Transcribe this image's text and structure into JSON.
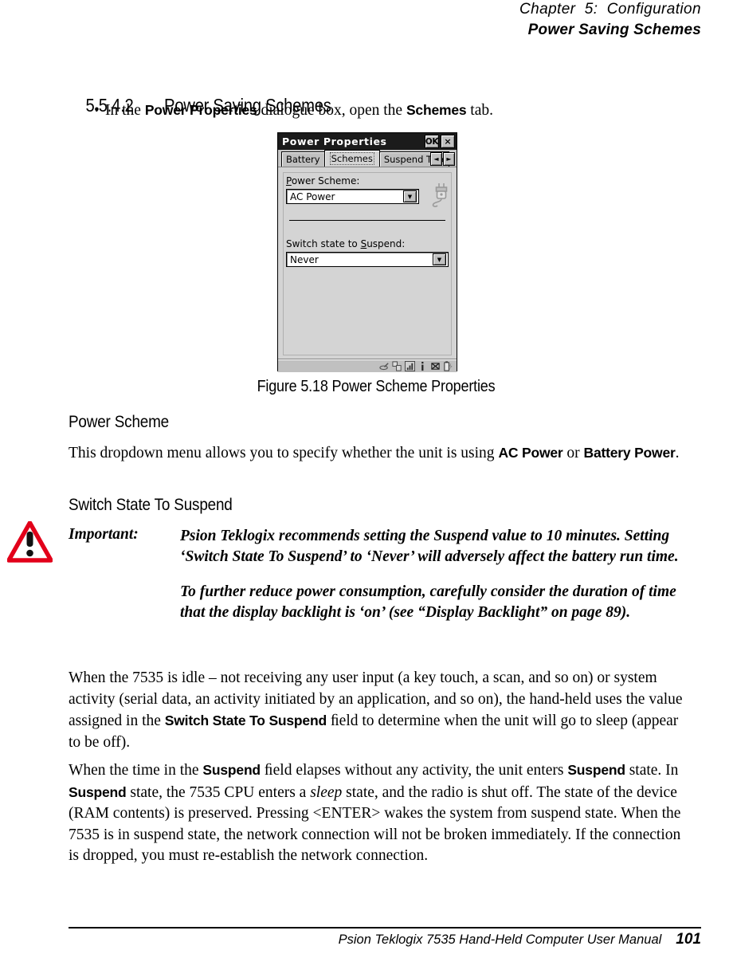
{
  "header": {
    "chapter": "Chapter  5:  Configuration",
    "section": "Power Saving Schemes"
  },
  "section": {
    "number": "5.5.4.2",
    "title": "Power Saving Schemes"
  },
  "bullet": {
    "marker": "•",
    "pre": "In the ",
    "ui1": "Power Properties",
    "mid": " dialogue box, open the ",
    "ui2": "Schemes",
    "post": " tab."
  },
  "dialog": {
    "title": "Power Properties",
    "ok_label": "OK",
    "close_label": "×",
    "tabs": [
      {
        "label": "Battery",
        "active": false
      },
      {
        "label": "Schemes",
        "active": true
      },
      {
        "label": "Suspend Thres",
        "active": false
      }
    ],
    "scroll_left": "◄",
    "scroll_right": "►",
    "power_scheme": {
      "label_u": "P",
      "label_rest": "ower Scheme:",
      "value": "AC Power",
      "arrow": "▼"
    },
    "switch_state": {
      "label_pre": "Switch state to ",
      "label_u": "S",
      "label_rest": "uspend:",
      "value": "Never",
      "arrow": "▼"
    },
    "tray_icons": [
      "stylus-icon",
      "network-connection-icon",
      "signal-strength-icon",
      "info-icon",
      "no-radio-icon",
      "battery-charging-icon"
    ]
  },
  "figure": {
    "caption": "Figure 5.18 Power Scheme Properties"
  },
  "power_scheme_section": {
    "heading": "Power Scheme",
    "body_pre": "This dropdown menu allows you to specify whether the unit is using ",
    "body_ui1": "AC Power",
    "body_mid": " or ",
    "body_ui2": "Battery Power",
    "body_post": "."
  },
  "switch_state_section": {
    "heading": "Switch State To Suspend",
    "note_label": "Important:",
    "note_para1": "Psion Teklogix recommends setting the Suspend value to 10 minutes. Setting ‘Switch State To Suspend’ to ‘Never’ will adversely affect the battery run time.",
    "note_para2": "To further reduce power consumption, carefully consider the duration of time that the display backlight is ‘on’ (see “Display Backlight” on page 89)."
  },
  "paragraphs": {
    "p1_pre": "When the 7535 is idle – not receiving any user input (a key touch, a scan, and so on) or system activity (serial data, an activity initiated by an application, and so on), the hand-held uses the value assigned in the ",
    "p1_ui": "Switch State To Suspend",
    "p1_post": " ﬁeld to determine when the unit will go to sleep (appear to be off).",
    "p2_a": "When the time in the ",
    "p2_ui1": "Suspend",
    "p2_b": " ﬁeld elapses without any activity, the unit enters ",
    "p2_ui2": "Suspend",
    "p2_c": " state. In ",
    "p2_ui3": "Suspend",
    "p2_d": " state, the 7535 CPU enters a ",
    "p2_em": "sleep",
    "p2_e": " state, and the radio is shut off. The state of the device (RAM contents) is preserved. Pressing <ENTER> wakes the system from suspend state. When the 7535 is in suspend state, the network connection will not be broken immediately. If the connection is dropped, you must re-establish the network connection."
  },
  "footer": {
    "manual": "Psion Teklogix 7535 Hand-Held Computer User Manual",
    "page": "101"
  },
  "colors": {
    "warning_red": "#e2001a",
    "titlebar": "#1b1b1b",
    "dialog_face": "#d4d4d4"
  }
}
